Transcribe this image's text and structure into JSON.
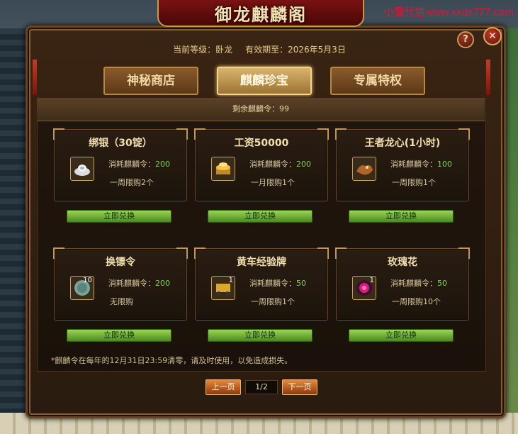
{
  "watermark": "小雪代售www.xxds777.com",
  "window": {
    "title": "御龙麒麟阁",
    "help_label": "?",
    "close_label": "✕"
  },
  "status": {
    "level_text": "当前等级：卧龙",
    "expiry_text": "有效期至：2026年5月3日"
  },
  "tabs": [
    {
      "label": "神秘商店",
      "active": false
    },
    {
      "label": "麒麟珍宝",
      "active": true
    },
    {
      "label": "专属特权",
      "active": false
    }
  ],
  "remaining": "剩余麒麟令：99",
  "items": [
    {
      "name": "绑银（30锭）",
      "cost_label": "消耗麒麟令：",
      "cost": "200",
      "limit": "一周限购2个",
      "button": "立即兑换",
      "icon": "silver-ingot-icon",
      "count": ""
    },
    {
      "name": "工资50000",
      "cost_label": "消耗麒麟令：",
      "cost": "200",
      "limit": "一月限购1个",
      "button": "立即兑换",
      "icon": "gold-coin-icon",
      "count": ""
    },
    {
      "name": "王者龙心(1小时)",
      "cost_label": "消耗麒麟令：",
      "cost": "100",
      "limit": "一周限购1个",
      "button": "立即兑换",
      "icon": "dragon-heart-icon",
      "count": ""
    },
    {
      "name": "换镖令",
      "cost_label": "消耗麒麟令：",
      "cost": "200",
      "limit": "无限购",
      "button": "立即兑换",
      "icon": "token-icon",
      "count": "10"
    },
    {
      "name": "黄车经验牌",
      "cost_label": "消耗麒麟令：",
      "cost": "50",
      "limit": "一周限购1个",
      "button": "立即兑换",
      "icon": "cart-exp-icon",
      "count": "1"
    },
    {
      "name": "玫瑰花",
      "cost_label": "消耗麒麟令：",
      "cost": "50",
      "limit": "一周限购10个",
      "button": "立即兑换",
      "icon": "rose-icon",
      "count": "1"
    }
  ],
  "note": "*麒麟令在每年的12月31日23:59清零，请及时使用，以免造成损失。",
  "pager": {
    "prev": "上一页",
    "page": "1/2",
    "next": "下一页"
  }
}
